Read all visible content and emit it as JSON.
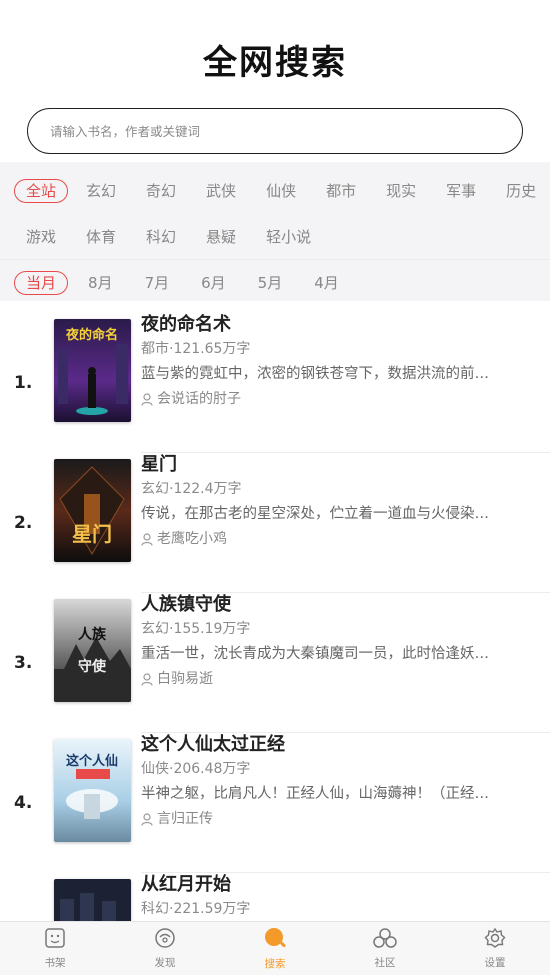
{
  "header": {
    "title": "全网搜索"
  },
  "search": {
    "placeholder": "请输入书名，作者或关键词",
    "value": ""
  },
  "categories": {
    "row1": [
      "全站",
      "玄幻",
      "奇幻",
      "武侠",
      "仙侠",
      "都市",
      "现实",
      "军事",
      "历史"
    ],
    "row2": [
      "游戏",
      "体育",
      "科幻",
      "悬疑",
      "轻小说"
    ],
    "selected": "全站"
  },
  "months": {
    "items": [
      "当月",
      "8月",
      "7月",
      "6月",
      "5月",
      "4月"
    ],
    "selected": "当月"
  },
  "books": [
    {
      "rank": "1.",
      "title": "夜的命名术",
      "meta": "都市·121.65万字",
      "desc": "蓝与紫的霓虹中，浓密的钢铁苍穹下，数据洪流的前…",
      "author": "会说话的肘子"
    },
    {
      "rank": "2.",
      "title": "星门",
      "meta": "玄幻·122.4万字",
      "desc": "传说，在那古老的星空深处，伫立着一道血与火侵染…",
      "author": "老鹰吃小鸡"
    },
    {
      "rank": "3.",
      "title": "人族镇守使",
      "meta": "玄幻·155.19万字",
      "desc": "重活一世，沈长青成为大秦镇魔司一员，此时恰逢妖…",
      "author": "白驹易逝"
    },
    {
      "rank": "4.",
      "title": "这个人仙太过正经",
      "meta": "仙侠·206.48万字",
      "desc": "半神之躯，比肩凡人！正经人仙，山海薅神！（正经…",
      "author": "言归正传"
    },
    {
      "rank": "",
      "title": "从红月开始",
      "meta": "科幻·221.59万字",
      "desc": "",
      "author": ""
    }
  ],
  "tabbar": {
    "items": [
      {
        "label": "书架",
        "icon": "bookshelf-icon"
      },
      {
        "label": "发现",
        "icon": "discover-icon"
      },
      {
        "label": "搜索",
        "icon": "search-icon"
      },
      {
        "label": "社区",
        "icon": "community-icon"
      },
      {
        "label": "设置",
        "icon": "settings-icon"
      }
    ],
    "active": "搜索"
  },
  "colors": {
    "accent": "#e84a4a",
    "tab_active": "#f39a2a"
  }
}
